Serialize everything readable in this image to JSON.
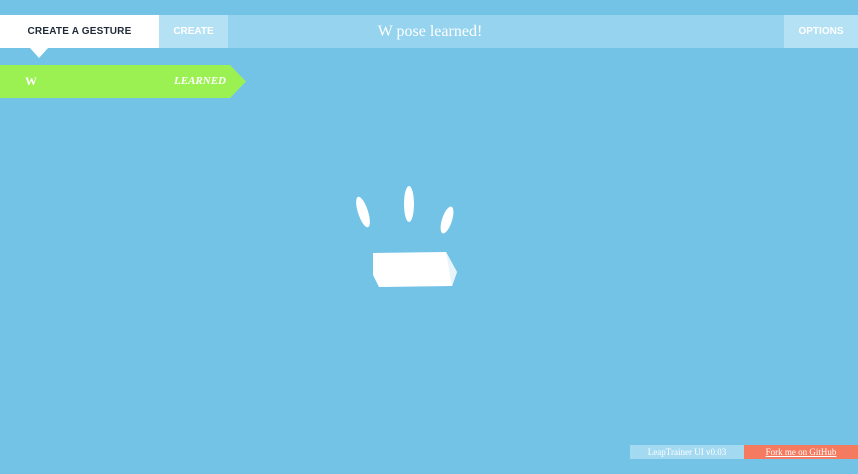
{
  "nav": {
    "create_gesture_tab": "CREATE A GESTURE",
    "create_tab": "CREATE",
    "options_tab": "OPTIONS"
  },
  "status": {
    "message": "W pose learned!"
  },
  "gestures": [
    {
      "name": "W",
      "status": "LEARNED"
    }
  ],
  "footer": {
    "version": "LeapTrainer UI v0.03",
    "fork_link": "Fork me on GitHub"
  },
  "colors": {
    "background": "#73c3e7",
    "topbar": "#95d3ee",
    "gesture_learned": "#9cf152",
    "fork_button": "#f47a60"
  },
  "icons": {
    "hand_visualization": "hand-pose-icon"
  }
}
